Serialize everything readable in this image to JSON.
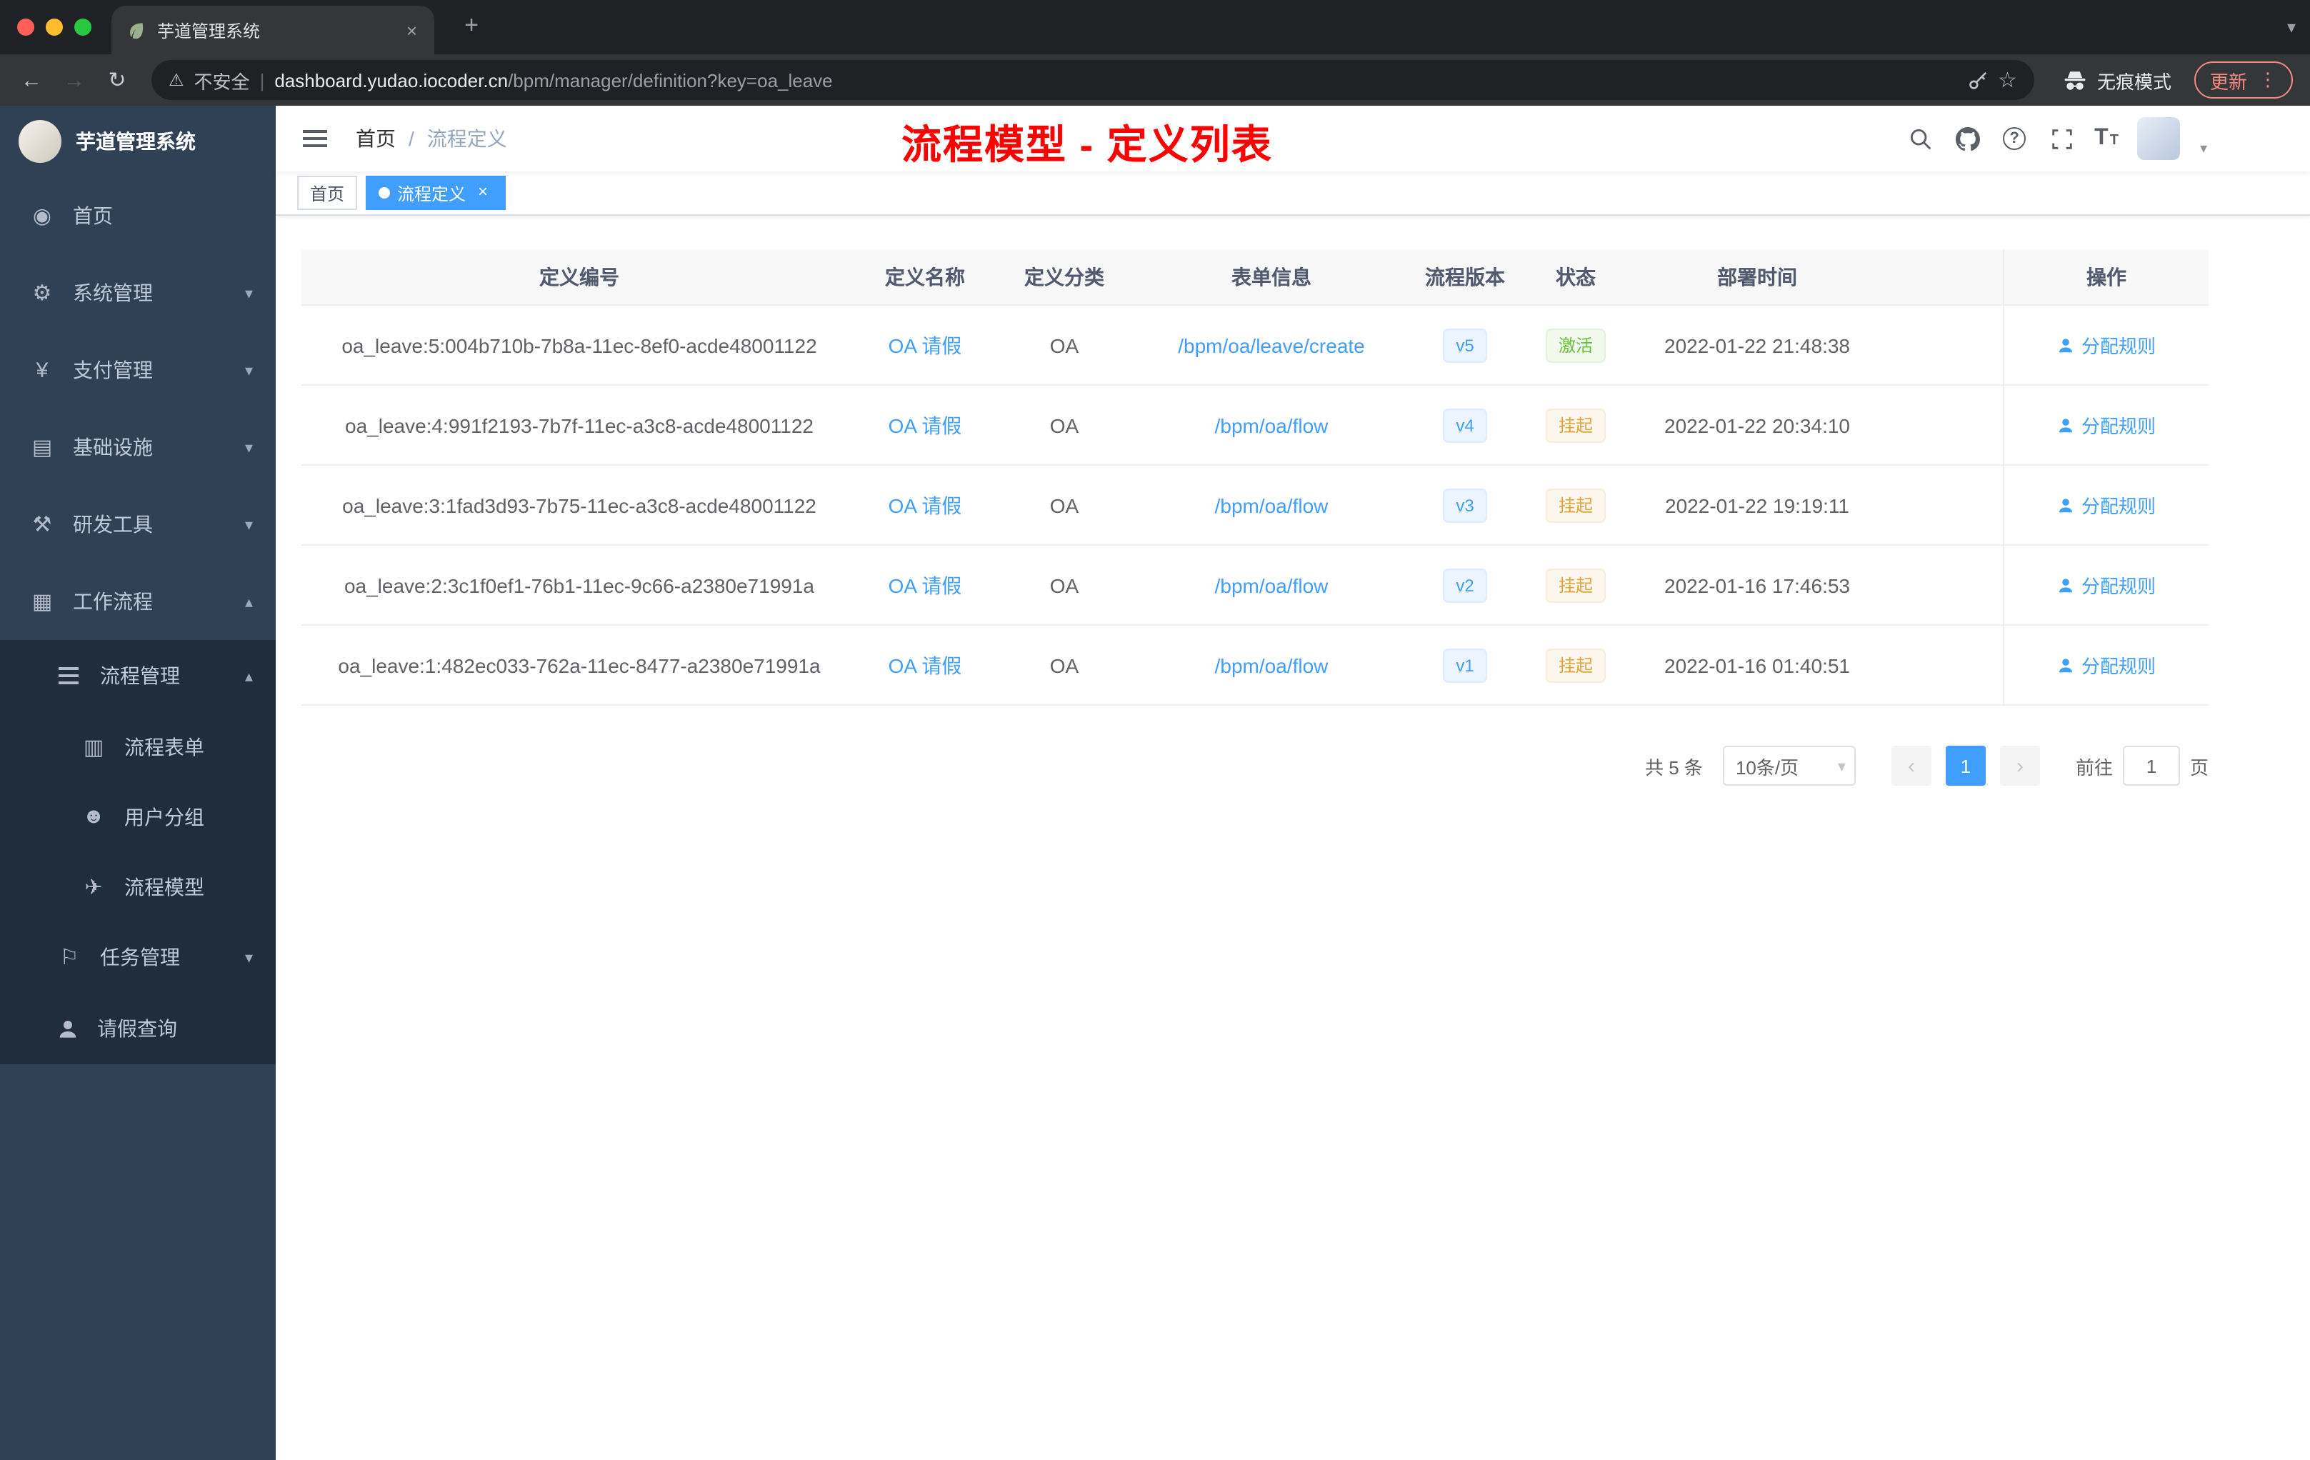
{
  "browser": {
    "tab": {
      "title": "芋道管理系统",
      "close": "×",
      "new_tab": "+"
    },
    "toolbar": {
      "security_label": "不安全",
      "url_domain": "dashboard.yudao.iocoder.cn",
      "url_path": "/bpm/manager/definition?key=oa_leave",
      "incognito_label": "无痕模式",
      "update_label": "更新"
    }
  },
  "icons": {
    "caret_down": "▾",
    "caret_up": "▴",
    "back": "←",
    "forward": "→",
    "reload": "↻",
    "warning": "⚠",
    "pipe": "|",
    "star": "☆",
    "kebab": "⋮",
    "dashboard": "◉",
    "gear": "⚙",
    "yen": "¥",
    "infra": "▤",
    "tools": "⚒",
    "workflow": "▦",
    "form": "▥",
    "users": "☻",
    "send": "✈",
    "flag": "⚐",
    "question": "?",
    "font_size": "T"
  },
  "sidebar": {
    "logo_title": "芋道管理系统",
    "menu": [
      {
        "label": "首页"
      },
      {
        "label": "系统管理"
      },
      {
        "label": "支付管理"
      },
      {
        "label": "基础设施"
      },
      {
        "label": "研发工具"
      },
      {
        "label": "工作流程",
        "children": [
          {
            "label": "流程管理",
            "children": [
              {
                "label": "流程表单"
              },
              {
                "label": "用户分组"
              },
              {
                "label": "流程模型"
              }
            ]
          },
          {
            "label": "任务管理"
          },
          {
            "label": "请假查询"
          }
        ]
      }
    ]
  },
  "header": {
    "breadcrumb": [
      "首页",
      "流程定义"
    ],
    "breadcrumb_sep": "/",
    "annotation": "流程模型 - 定义列表"
  },
  "tags": [
    {
      "label": "首页"
    },
    {
      "label": "流程定义",
      "active": true,
      "close": "×"
    }
  ],
  "table": {
    "columns": [
      "定义编号",
      "定义名称",
      "定义分类",
      "表单信息",
      "流程版本",
      "状态",
      "部署时间",
      "操作"
    ],
    "rows": [
      {
        "id": "oa_leave:5:004b710b-7b8a-11ec-8ef0-acde48001122",
        "name": "OA 请假",
        "category": "OA",
        "form": "/bpm/oa/leave/create",
        "version": "v5",
        "status": "激活",
        "deploy_time": "2022-01-22 21:48:38",
        "action": "分配规则"
      },
      {
        "id": "oa_leave:4:991f2193-7b7f-11ec-a3c8-acde48001122",
        "name": "OA 请假",
        "category": "OA",
        "form": "/bpm/oa/flow",
        "version": "v4",
        "status": "挂起",
        "deploy_time": "2022-01-22 20:34:10",
        "action": "分配规则"
      },
      {
        "id": "oa_leave:3:1fad3d93-7b75-11ec-a3c8-acde48001122",
        "name": "OA 请假",
        "category": "OA",
        "form": "/bpm/oa/flow",
        "version": "v3",
        "status": "挂起",
        "deploy_time": "2022-01-22 19:19:11",
        "action": "分配规则"
      },
      {
        "id": "oa_leave:2:3c1f0ef1-76b1-11ec-9c66-a2380e71991a",
        "name": "OA 请假",
        "category": "OA",
        "form": "/bpm/oa/flow",
        "version": "v2",
        "status": "挂起",
        "deploy_time": "2022-01-16 17:46:53",
        "action": "分配规则"
      },
      {
        "id": "oa_leave:1:482ec033-762a-11ec-8477-a2380e71991a",
        "name": "OA 请假",
        "category": "OA",
        "form": "/bpm/oa/flow",
        "version": "v1",
        "status": "挂起",
        "deploy_time": "2022-01-16 01:40:51",
        "action": "分配规则"
      }
    ]
  },
  "pagination": {
    "total": "共 5 条",
    "page_size": "10条/页",
    "prev": "‹",
    "page": "1",
    "next": "›",
    "goto_prefix": "前往",
    "goto_value": "1",
    "goto_suffix": "页"
  },
  "colors": {
    "accent": "#409eff",
    "success": "#67c23a",
    "warning": "#e6a23c",
    "annotation": "#ff0000",
    "sidebar_bg": "#304156",
    "submenu_bg": "#1f2d3d"
  }
}
